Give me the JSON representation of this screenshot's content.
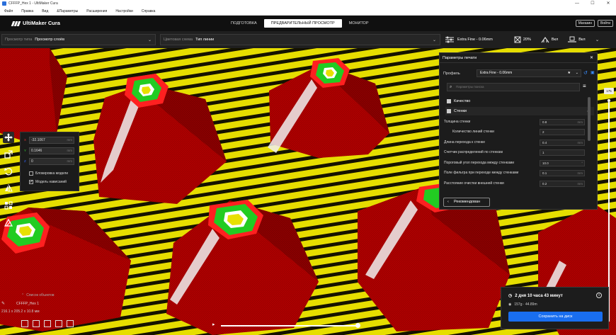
{
  "window": {
    "title": "CFFFP_Hex 1 - UltiMaker Cura",
    "controls": [
      "—",
      "☐",
      "✕"
    ]
  },
  "menu": [
    "Файл",
    "Правка",
    "Вид",
    "&Параметры",
    "Расширения",
    "Настройки",
    "Справка"
  ],
  "header": {
    "brand": "UltiMaker Cura",
    "stages": [
      {
        "label": "ПОДГОТОВКА",
        "active": false
      },
      {
        "label": "ПРЕДВАРИТЕЛЬНЫЙ ПРОСМОТР",
        "active": true
      },
      {
        "label": "МОНИТОР",
        "active": false
      }
    ],
    "marketplace": "Магазин",
    "signin": "Войти"
  },
  "toolbar": {
    "view_type_label": "Просмотр типа",
    "view_type_value": "Просмотр слоёв",
    "color_scheme_label": "Цветовая схема",
    "color_scheme_value": "Тип линии",
    "profile_value": "Extra Fine - 0.06mm",
    "infill": "20%",
    "support": "Вкл",
    "adhesion": "Вкл"
  },
  "move_panel": {
    "x": "-32.1067",
    "y": "0.1646",
    "z": "0",
    "unit": "mm",
    "lock_model": "Блокировка модели",
    "drop_down": "Модель нависаний"
  },
  "print_settings": {
    "title": "Параметры печати",
    "profile_label": "Профиль",
    "profile_value": "Extra Fine - 0.06mm",
    "search_placeholder": "Параметры поиска",
    "categories": [
      {
        "label": "Качество",
        "expanded": false
      },
      {
        "label": "Стенки",
        "expanded": true
      }
    ],
    "settings": [
      {
        "label": "Толщина стенки",
        "value": "0.8",
        "unit": "mm",
        "indent": false
      },
      {
        "label": "Количество линий стенки",
        "value": "2",
        "unit": "",
        "indent": true
      },
      {
        "label": "Длина перехода к стенке",
        "value": "0.4",
        "unit": "mm",
        "indent": false
      },
      {
        "label": "Счетчик распределений по стенкам",
        "value": "1",
        "unit": "",
        "indent": false
      },
      {
        "label": "Пороговый угол перехода между стенками",
        "value": "10.0",
        "unit": "°",
        "indent": false
      },
      {
        "label": "Поле фильтра при переходе между стенками",
        "value": "0.1",
        "unit": "mm",
        "indent": false
      },
      {
        "label": "Расстояние очистки внешней стенки",
        "value": "0.2",
        "unit": "mm",
        "indent": false
      }
    ],
    "recommended_button": "Рекомендован"
  },
  "layer_slider": {
    "layer": "175"
  },
  "object_list": {
    "header": "Список объектов",
    "object_name": "CFFFP_Hex 1",
    "dimensions": "216.1 x 205.2 x 10.8 мм"
  },
  "print_info": {
    "time": "2 дня 10 часа 43 минут",
    "material": "157g · 44.89m",
    "save_button": "Сохранить на диск"
  },
  "colors": {
    "accent": "#196ef0",
    "wall_red": "#c00000",
    "infill_yellow": "#e8e000",
    "top_green": "#22cc22"
  }
}
